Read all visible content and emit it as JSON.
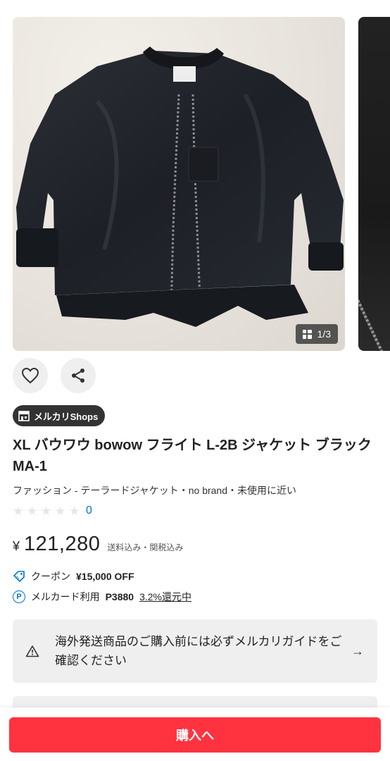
{
  "gallery": {
    "counter": "1/3",
    "counter_icon": "grid-icon"
  },
  "actions": {
    "like_icon": "heart-icon",
    "share_icon": "share-icon"
  },
  "shop_badge": {
    "label": "メルカリShops",
    "icon": "shop-icon"
  },
  "product": {
    "title": "XL バウワウ bowow フライト L-2B ジャケット ブラック MA-1",
    "category": "ファッション - テーラードジャケット・no brand・未使用に近い",
    "rating_count": "0",
    "stars_filled": 0,
    "stars_total": 5
  },
  "price": {
    "yen": "¥",
    "amount": "121,280",
    "tax_note": "送料込み・関税込み"
  },
  "coupon": {
    "label": "クーポン",
    "value": "¥15,000 OFF",
    "icon": "coupon-tag-icon",
    "color": "#0073cc"
  },
  "points": {
    "label": "メルカード利用",
    "value": "P3880",
    "rate": "3.2%還元中",
    "icon": "p-point-icon",
    "icon_letter": "P"
  },
  "notice": {
    "text": "海外発送商品のご購入前には必ずメルカリガイドをご確認ください",
    "icon": "warning-icon"
  },
  "buy_button": {
    "label": "購入へ",
    "color": "#ff333f"
  }
}
